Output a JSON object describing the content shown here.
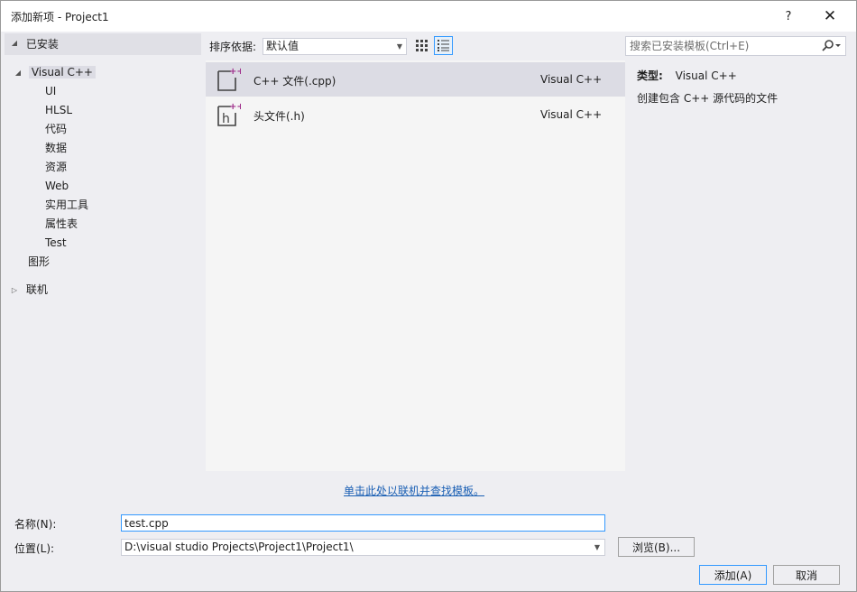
{
  "window": {
    "title": "添加新项 - Project1",
    "help_label": "?",
    "close_label": "✕"
  },
  "tree": {
    "installed": "已安装",
    "visual_cpp": "Visual C++",
    "children": [
      "UI",
      "HLSL",
      "代码",
      "数据",
      "资源",
      "Web",
      "实用工具",
      "属性表",
      "Test"
    ],
    "graphics": "图形",
    "online": "联机"
  },
  "toolbar": {
    "sort_label": "排序依据:",
    "sort_value": "默认值"
  },
  "templates": [
    {
      "name": "C++ 文件(.cpp)",
      "lang": "Visual C++",
      "selected": true,
      "glyph": ""
    },
    {
      "name": "头文件(.h)",
      "lang": "Visual C++",
      "selected": false,
      "glyph": "h"
    }
  ],
  "search": {
    "placeholder": "搜索已安装模板(Ctrl+E)"
  },
  "details": {
    "type_label": "类型:",
    "type_value": "Visual C++",
    "description": "创建包含 C++ 源代码的文件"
  },
  "online_link": "单击此处以联机并查找模板。",
  "form": {
    "name_label": "名称(N):",
    "name_value": "test.cpp",
    "location_label": "位置(L):",
    "location_value": "D:\\visual studio Projects\\Project1\\Project1\\",
    "browse_label": "浏览(B)...",
    "add_label": "添加(A)",
    "cancel_label": "取消"
  },
  "colors": {
    "accent": "#3399ff",
    "link": "#1a5fb4",
    "cpp_plus": "#a0308c",
    "selection": "#dcdce4"
  }
}
